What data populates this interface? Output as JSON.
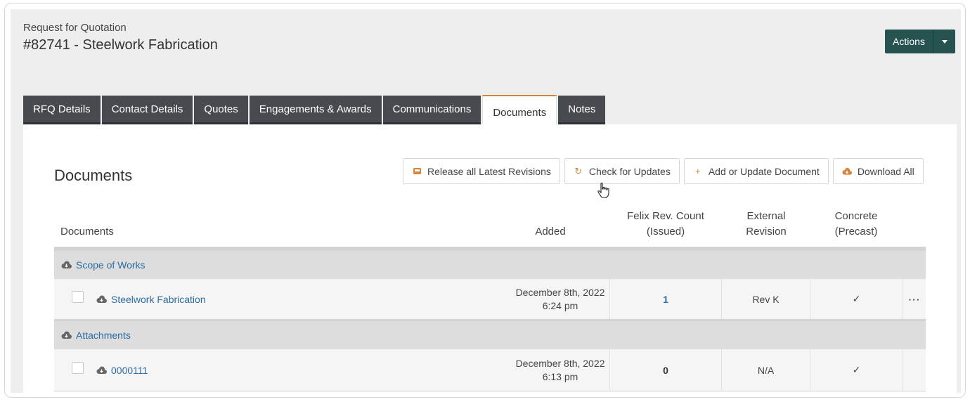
{
  "header": {
    "subtitle": "Request for Quotation",
    "title": "#82741 - Steelwork Fabrication",
    "actions_label": "Actions"
  },
  "tabs": [
    {
      "label": "RFQ Details",
      "active": false
    },
    {
      "label": "Contact Details",
      "active": false
    },
    {
      "label": "Quotes",
      "active": false
    },
    {
      "label": "Engagements & Awards",
      "active": false
    },
    {
      "label": "Communications",
      "active": false
    },
    {
      "label": "Documents",
      "active": true
    },
    {
      "label": "Notes",
      "active": false
    }
  ],
  "panel": {
    "title": "Documents",
    "toolbar": {
      "release_label": "Release all Latest Revisions",
      "check_label": "Check for Updates",
      "add_label": "Add or Update Document",
      "download_label": "Download All"
    }
  },
  "table": {
    "columns": {
      "documents": "Documents",
      "added": "Added",
      "felix_line1": "Felix Rev. Count",
      "felix_line2": "(Issued)",
      "external_line1": "External",
      "external_line2": "Revision",
      "concrete_line1": "Concrete",
      "concrete_line2": "(Precast)"
    },
    "groups": [
      {
        "name": "Scope of Works",
        "rows": [
          {
            "name": "Steelwork Fabrication",
            "date": "December 8th, 2022",
            "time": "6:24 pm",
            "felix": "1",
            "external": "Rev K",
            "concrete": "✓",
            "more": "···"
          }
        ]
      },
      {
        "name": "Attachments",
        "rows": [
          {
            "name": "0000111",
            "date": "December 8th, 2022",
            "time": "6:13 pm",
            "felix": "0",
            "external": "N/A",
            "concrete": "✓",
            "more": ""
          }
        ]
      }
    ]
  },
  "colors": {
    "accent": "#d9843b",
    "actions_bg": "#26534f",
    "tab_bg": "#474b4f",
    "link": "#2b6ca3"
  }
}
